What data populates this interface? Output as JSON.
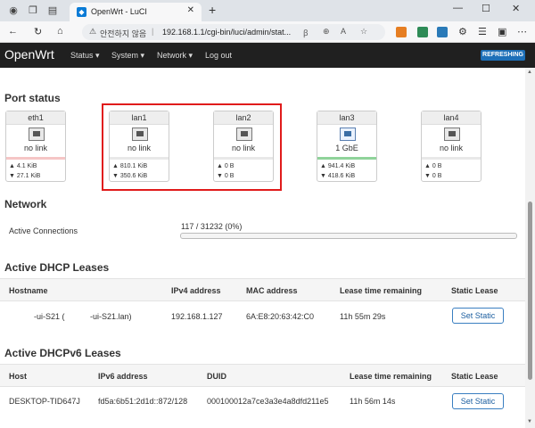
{
  "browser": {
    "tab_title": "OpenWrt - LuCI",
    "url_security": "안전하지 않음",
    "url": "192.168.1.1/cgi-bin/luci/admin/stat..."
  },
  "header": {
    "brand": "OpenWrt",
    "menu": [
      "Status ▾",
      "System ▾",
      "Network ▾",
      "Log out"
    ],
    "badge": "REFRESHING"
  },
  "port_status": {
    "title": "Port status",
    "ports": [
      {
        "name": "eth1",
        "status": "no link",
        "rx": "▲ 4.1 KiB",
        "tx": "▼ 27.1 KiB",
        "link_up": false,
        "bar_color": "#f5c6c6"
      },
      {
        "name": "lan1",
        "status": "no link",
        "rx": "▲ 810.1 KiB",
        "tx": "▼ 350.6 KiB",
        "link_up": false,
        "bar_color": "#e8e8e8"
      },
      {
        "name": "lan2",
        "status": "no link",
        "rx": "▲ 0 B",
        "tx": "▼ 0 B",
        "link_up": false,
        "bar_color": "#e8e8e8"
      },
      {
        "name": "lan3",
        "status": "1 GbE",
        "rx": "▲ 941.4 KiB",
        "tx": "▼ 418.6 KiB",
        "link_up": true,
        "bar_color": "#8fd39a"
      },
      {
        "name": "lan4",
        "status": "no link",
        "rx": "▲ 0 B",
        "tx": "▼ 0 B",
        "link_up": false,
        "bar_color": "#e8e8e8"
      }
    ]
  },
  "network": {
    "title": "Network",
    "active_connections_label": "Active Connections",
    "active_connections_value": "117 / 31232 (0%)",
    "active_connections_fraction": 0.004
  },
  "dhcp": {
    "title": "Active DHCP Leases",
    "columns": [
      "Hostname",
      "IPv4 address",
      "MAC address",
      "Lease time remaining",
      "Static Lease"
    ],
    "rows": [
      {
        "hostname": "-ui-S21 (",
        "hostname2": "-ui-S21.lan)",
        "ipv4": "192.168.1.127",
        "mac": "6A:E8:20:63:42:C0",
        "lease": "11h 55m 29s",
        "button": "Set Static"
      }
    ]
  },
  "dhcpv6": {
    "title": "Active DHCPv6 Leases",
    "columns": [
      "Host",
      "IPv6 address",
      "DUID",
      "Lease time remaining",
      "Static Lease"
    ],
    "rows": [
      {
        "host": "DESKTOP-TID647J",
        "ipv6": "fd5a:6b51:2d1d::872/128",
        "duid": "000100012a7ce3a3e4a8dfd211e5",
        "lease": "11h 56m 14s",
        "button": "Set Static"
      }
    ]
  }
}
